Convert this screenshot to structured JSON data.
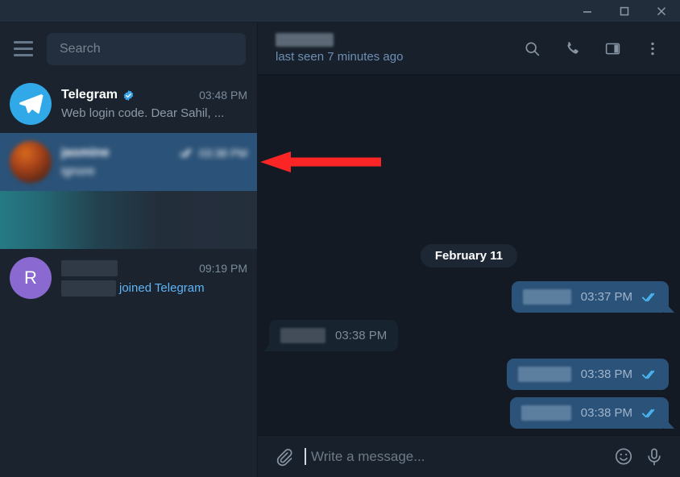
{
  "window": {
    "minimize_label": "Minimize",
    "maximize_label": "Maximize",
    "close_label": "Close"
  },
  "sidebar": {
    "menu_icon": "hamburger-menu-icon",
    "search": {
      "placeholder": "Search",
      "value": ""
    },
    "chats": [
      {
        "name": "Telegram",
        "verified": true,
        "time": "03:48 PM",
        "snippet": "Web login code. Dear Sahil, ...",
        "avatar_type": "telegram-logo",
        "selected": false,
        "redacted": false
      },
      {
        "name": "jasmine",
        "verified": false,
        "time": "03:38 PM",
        "snippet": "ignore",
        "avatar_type": "photo",
        "selected": true,
        "redacted": true,
        "read_state": "read"
      },
      {
        "name": "",
        "time": "",
        "snippet": "",
        "avatar_type": "blurred",
        "selected": false,
        "redacted": true
      },
      {
        "name": "",
        "verified": false,
        "time": "09:19 PM",
        "snippet": "joined Telegram",
        "snippet_is_link": true,
        "avatar_type": "letter",
        "avatar_letter": "R",
        "selected": false,
        "redacted": false
      }
    ]
  },
  "chat": {
    "header": {
      "title": "",
      "status": "last seen 7 minutes ago",
      "icons": [
        "search-icon",
        "phone-icon",
        "panel-icon",
        "more-vertical-icon"
      ]
    },
    "date_divider": "February 11",
    "messages": [
      {
        "direction": "out",
        "text": "",
        "time": "03:37 PM",
        "status": "read",
        "tail": true
      },
      {
        "direction": "in",
        "text": "",
        "time": "03:38 PM",
        "status": "",
        "tail": true
      },
      {
        "direction": "out",
        "text": "",
        "time": "03:38 PM",
        "status": "read",
        "tail": false
      },
      {
        "direction": "out",
        "text": "",
        "time": "03:38 PM",
        "status": "read",
        "tail": true
      }
    ],
    "composer": {
      "attach_icon": "paperclip-icon",
      "placeholder": "Write a message...",
      "value": "",
      "emoji_icon": "smiley-icon",
      "mic_icon": "microphone-icon"
    }
  },
  "annotation": {
    "type": "arrow",
    "direction": "left",
    "color": "#fc2525"
  },
  "colors": {
    "accent": "#31a8e8",
    "selected_row": "#2b5278",
    "out_bubble": "#2b5278",
    "in_bubble": "#182330",
    "sidebar_bg": "#1b232e",
    "chat_bg": "#131a23",
    "titlebar_bg": "#222d3b",
    "annotation_red": "#fc2525"
  }
}
